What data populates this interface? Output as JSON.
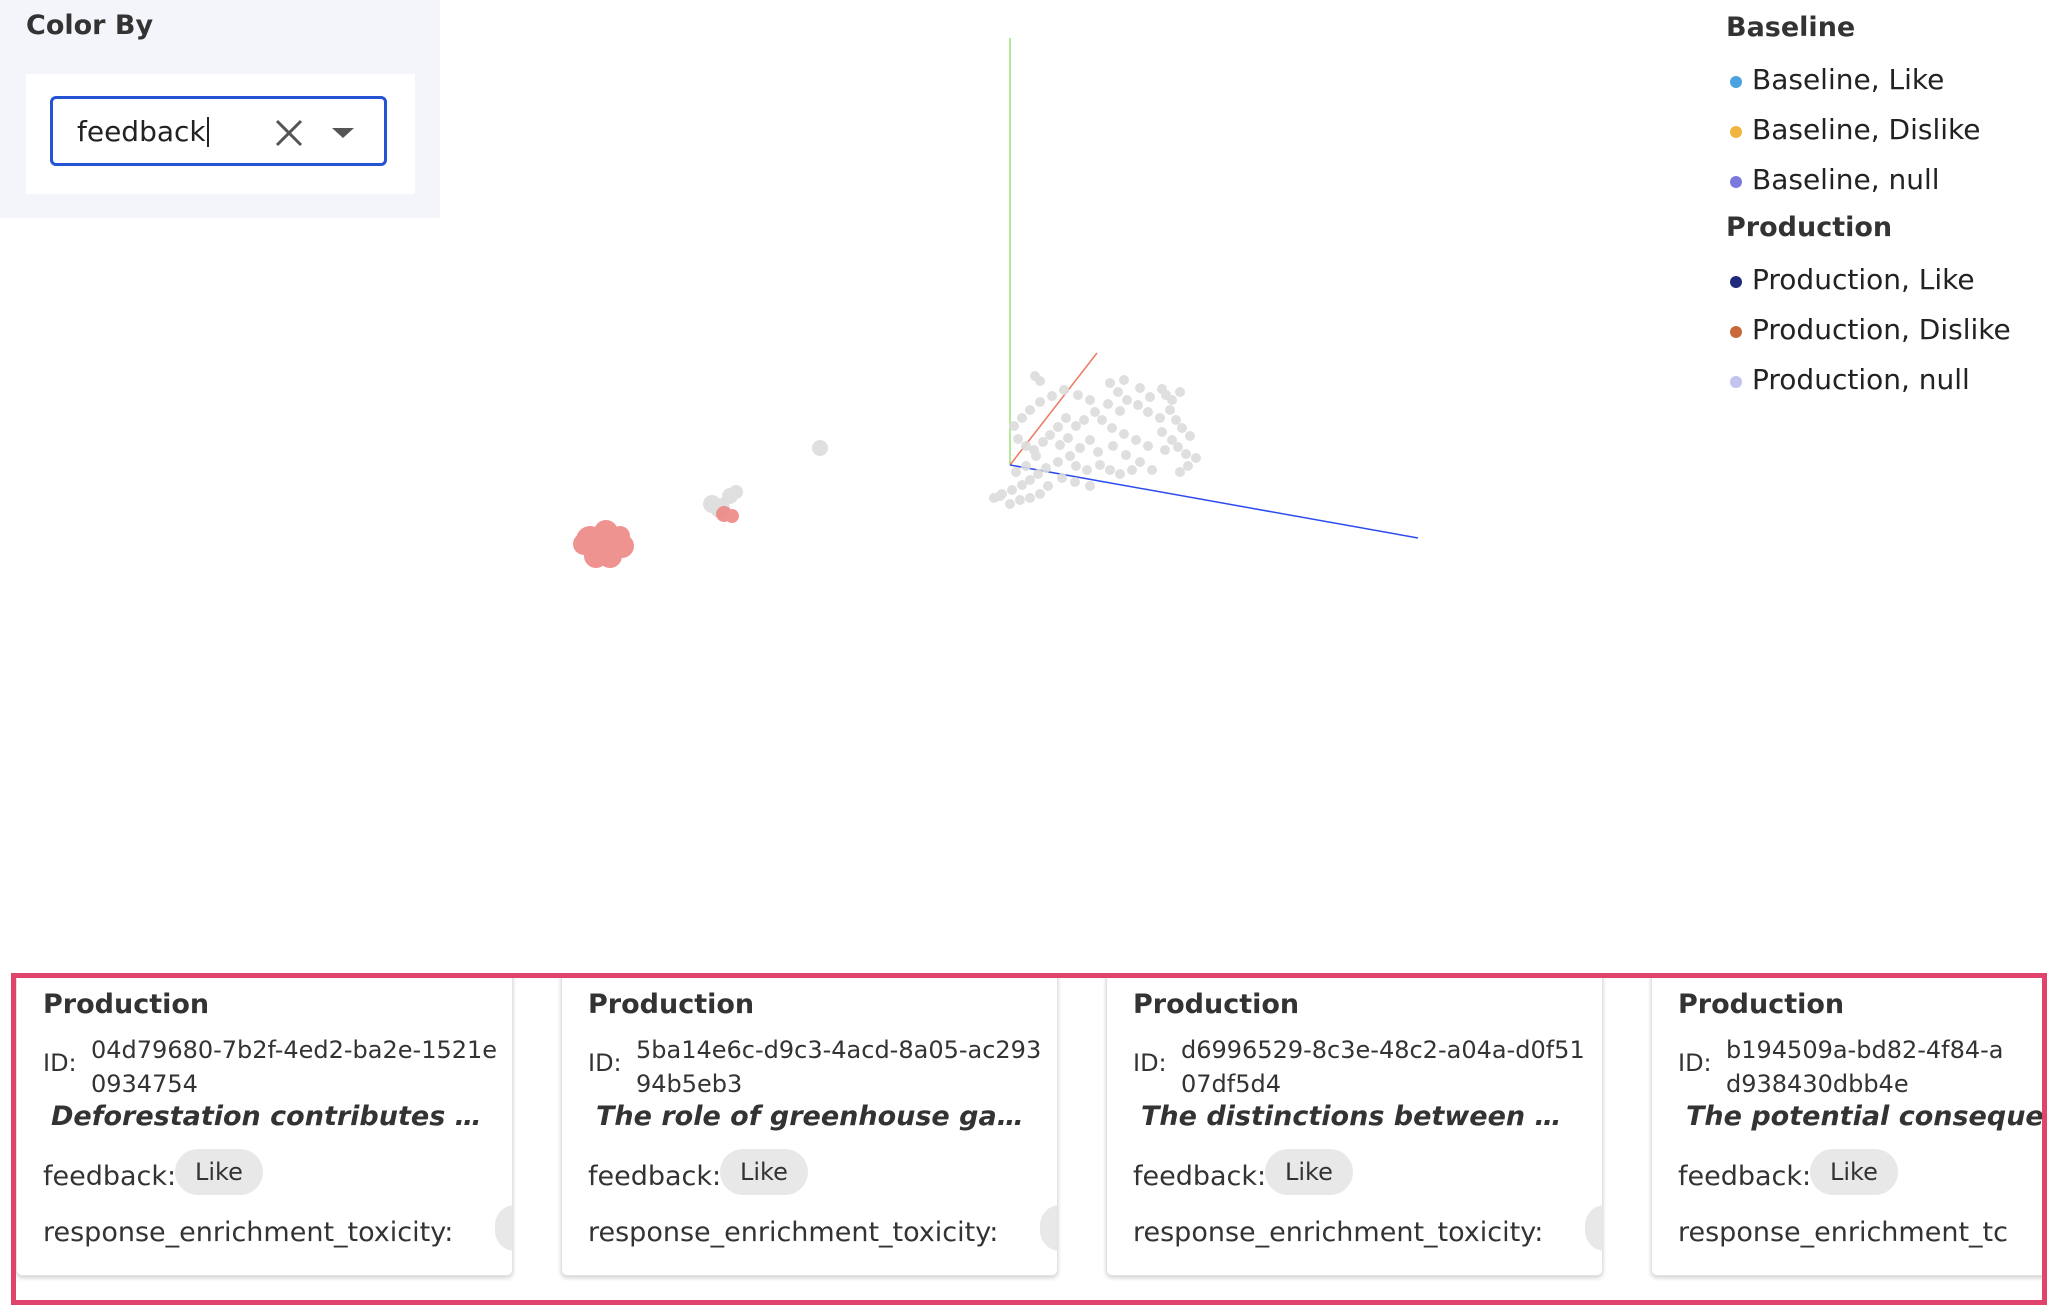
{
  "colorBy": {
    "title": "Color By",
    "value": "feedback",
    "icons": {
      "clear": "close-icon",
      "dropdown": "caret-down-icon"
    }
  },
  "scatter": {
    "axisColors": {
      "x": "#2b4bf0",
      "y": "#9be07a",
      "z": "#f07860"
    },
    "pointColors": {
      "neutral": "#dcdcdc",
      "highlight": "#ee8a87"
    }
  },
  "legend": {
    "groups": [
      {
        "title": "Baseline",
        "items": [
          {
            "label": "Baseline, Like",
            "color": "#4aa3df"
          },
          {
            "label": "Baseline, Dislike",
            "color": "#f2b441"
          },
          {
            "label": "Baseline, null",
            "color": "#7b79e0"
          }
        ]
      },
      {
        "title": "Production",
        "items": [
          {
            "label": "Production, Like",
            "color": "#1f2a7a"
          },
          {
            "label": "Production, Dislike",
            "color": "#c9683b"
          },
          {
            "label": "Production, null",
            "color": "#c2c3ef"
          }
        ]
      }
    ]
  },
  "cards": [
    {
      "title": "Production",
      "id_label": "ID:",
      "id": "04d79680-7b2f-4ed2-ba2e-1521e0934754",
      "text": "Deforestation contributes to…",
      "feedback_label": "feedback:",
      "feedback_value": "Like",
      "toxicity_label": "response_enrichment_toxicity:"
    },
    {
      "title": "Production",
      "id_label": "ID:",
      "id": "5ba14e6c-d9c3-4acd-8a05-ac29394b5eb3",
      "text": "The role of greenhouse gase…",
      "feedback_label": "feedback:",
      "feedback_value": "Like",
      "toxicity_label": "response_enrichment_toxicity:"
    },
    {
      "title": "Production",
      "id_label": "ID:",
      "id": "d6996529-8c3e-48c2-a04a-d0f5107df5d4",
      "text": "The distinctions between w…",
      "feedback_label": "feedback:",
      "feedback_value": "Like",
      "toxicity_label": "response_enrichment_toxicity:"
    },
    {
      "title": "Production",
      "id_label": "ID:",
      "id": "b194509a-bd82-4f84-a",
      "id_line2": "d938430dbb4e",
      "text": "The potential conseque",
      "feedback_label": "feedback:",
      "feedback_value": "Like",
      "toxicity_label": "response_enrichment_tc"
    }
  ]
}
